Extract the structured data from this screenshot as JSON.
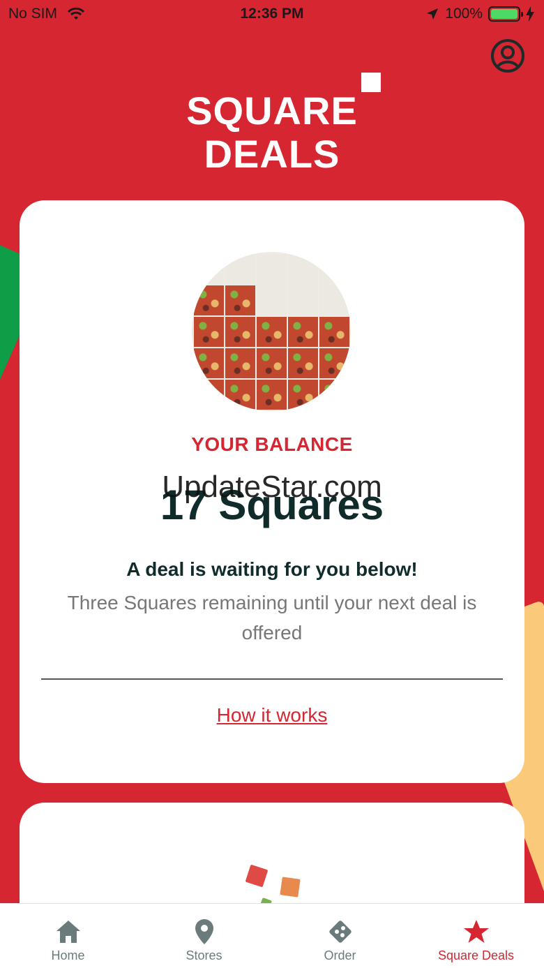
{
  "status_bar": {
    "carrier": "No SIM",
    "time": "12:36 PM",
    "battery": "100%"
  },
  "header": {
    "logo_line1": "SQUARE",
    "logo_line2": "DEALS"
  },
  "balance_card": {
    "label": "YOUR BALANCE",
    "value": "17 Squares",
    "watermark": "UpdateStar.com",
    "deal_title": "A deal is waiting for you below!",
    "deal_subtitle": "Three Squares remaining until your next deal is offered",
    "link": "How it works"
  },
  "tabs": [
    {
      "label": "Home",
      "icon": "home-icon"
    },
    {
      "label": "Stores",
      "icon": "map-pin-icon"
    },
    {
      "label": "Order",
      "icon": "pizza-icon"
    },
    {
      "label": "Square Deals",
      "icon": "star-icon"
    }
  ],
  "colors": {
    "brand_red": "#d62632",
    "dark_text": "#0f2b2a",
    "green": "#0f9d48",
    "orange": "#fbc97a"
  }
}
